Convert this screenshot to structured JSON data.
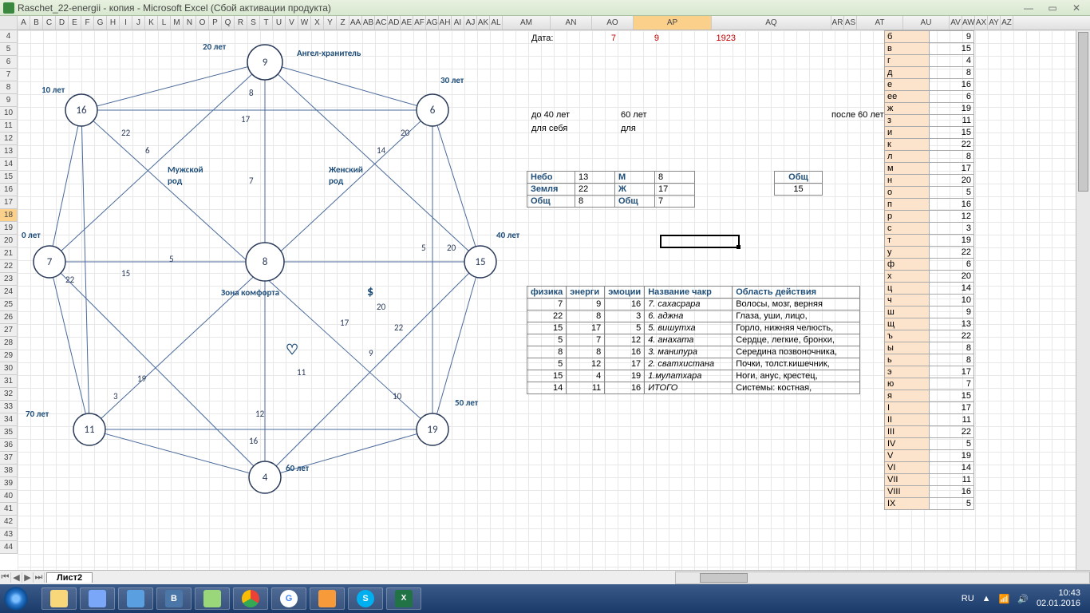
{
  "window": {
    "title": "Raschet_22-energii - копия - Microsoft Excel (Сбой активации продукта)"
  },
  "columns": [
    "A",
    "B",
    "C",
    "D",
    "E",
    "F",
    "G",
    "H",
    "I",
    "J",
    "K",
    "L",
    "M",
    "N",
    "O",
    "P",
    "Q",
    "R",
    "S",
    "T",
    "U",
    "V",
    "W",
    "X",
    "Y",
    "Z",
    "AA",
    "AB",
    "AC",
    "AD",
    "AE",
    "AF",
    "AG",
    "AH",
    "AI",
    "AJ",
    "AK",
    "AL",
    "AM",
    "AN",
    "AO",
    "AP",
    "AQ",
    "AR",
    "AS",
    "AT",
    "AU",
    "AV",
    "AW",
    "AX",
    "AY",
    "AZ"
  ],
  "selected_column_index": 41,
  "rows_start": 4,
  "rows_end": 44,
  "diagram": {
    "title_top": "Ангел-хранитель",
    "age0": "0 лет",
    "age10": "10 лет",
    "age20": "20 лет",
    "age30": "30 лет",
    "age40": "40 лет",
    "age50": "50 лет",
    "age60": "60 лет",
    "age70": "70 лет",
    "male": "Мужской\nрод",
    "female": "Женский\nрод",
    "comfort": "Зона комфорта",
    "dollar": "$",
    "heart": "♡",
    "c_top": "9",
    "c_tr": "6",
    "c_right": "15",
    "c_br": "19",
    "c_bottom": "4",
    "c_bl": "11",
    "c_left": "7",
    "c_tl": "16",
    "c_center": "8",
    "n8": "8",
    "n17": "17",
    "n22a": "22",
    "n6": "6",
    "n20": "20",
    "n14": "14",
    "n7": "7",
    "n5a": "5",
    "n5b": "5",
    "n20b": "20",
    "n22b": "22",
    "n15": "15",
    "n17b": "17",
    "n20c": "20",
    "n22c": "22",
    "n9": "9",
    "n19": "19",
    "n3": "3",
    "n11": "11",
    "n10": "10",
    "n12": "12",
    "n16": "16"
  },
  "date_row": {
    "label": "Дата:",
    "d": "7",
    "m": "9",
    "y": "1923"
  },
  "periods": {
    "before40": "до 40 лет",
    "sixty": "60 лет",
    "after60": "после 60 лет",
    "self": "для себя",
    "for": "для"
  },
  "mini": {
    "nebo": "Небо",
    "nebo_v": "13",
    "m": "М",
    "m_v": "8",
    "obsh": "Общ",
    "zemlya": "Земля",
    "zemlya_v": "22",
    "zh": "Ж",
    "zh_v": "17",
    "obsh_v": "15",
    "obsh2": "Общ",
    "obsh2_v": "8",
    "obsh3": "Общ",
    "obsh3_v": "7"
  },
  "chakra": {
    "headers": [
      "физика",
      "энерги",
      "эмоции",
      "Название чакр",
      "Область действия"
    ],
    "rows": [
      [
        "7",
        "9",
        "16",
        "7. сахасрара",
        "Волосы, мозг, верняя"
      ],
      [
        "22",
        "8",
        "3",
        "6. аджна",
        "Глаза, уши, лицо,"
      ],
      [
        "15",
        "17",
        "5",
        "5. вишутха",
        "Горло, нижняя челюсть,"
      ],
      [
        "5",
        "7",
        "12",
        "4. анахата",
        "Сердце, легкие, бронхи,"
      ],
      [
        "8",
        "8",
        "16",
        "3. манипура",
        "Середина позвоночника,"
      ],
      [
        "5",
        "12",
        "17",
        "2. сватхистана",
        "Почки, толст.кишечник,"
      ],
      [
        "15",
        "4",
        "19",
        "1.мулатхара",
        "Ноги, анус, крестец,"
      ],
      [
        "14",
        "11",
        "16",
        "ИТОГО",
        "Системы: костная,"
      ]
    ]
  },
  "letters": [
    [
      "б",
      "9"
    ],
    [
      "в",
      "15"
    ],
    [
      "г",
      "4"
    ],
    [
      "д",
      "8"
    ],
    [
      "е",
      "16"
    ],
    [
      "ее",
      "6"
    ],
    [
      "ж",
      "19"
    ],
    [
      "з",
      "11"
    ],
    [
      "и",
      "15"
    ],
    [
      "к",
      "22"
    ],
    [
      "л",
      "8"
    ],
    [
      "м",
      "17"
    ],
    [
      "н",
      "20"
    ],
    [
      "о",
      "5"
    ],
    [
      "п",
      "16"
    ],
    [
      "р",
      "12"
    ],
    [
      "с",
      "3"
    ],
    [
      "т",
      "19"
    ],
    [
      "у",
      "22"
    ],
    [
      "ф",
      "6"
    ],
    [
      "х",
      "20"
    ],
    [
      "ц",
      "14"
    ],
    [
      "ч",
      "10"
    ],
    [
      "ш",
      "9"
    ],
    [
      "щ",
      "13"
    ],
    [
      "ъ",
      "22"
    ],
    [
      "ы",
      "8"
    ],
    [
      "ь",
      "8"
    ],
    [
      "э",
      "17"
    ],
    [
      "ю",
      "7"
    ],
    [
      "я",
      "15"
    ],
    [
      "I",
      "17"
    ],
    [
      "II",
      "11"
    ],
    [
      "III",
      "22"
    ],
    [
      "IV",
      "5"
    ],
    [
      "V",
      "19"
    ],
    [
      "VI",
      "14"
    ],
    [
      "VII",
      "11"
    ],
    [
      "VIII",
      "16"
    ],
    [
      "IX",
      "5"
    ]
  ],
  "sheet_tab": "Лист2",
  "lang": "RU",
  "clock": {
    "time": "10:43",
    "date": "02.01.2016"
  }
}
